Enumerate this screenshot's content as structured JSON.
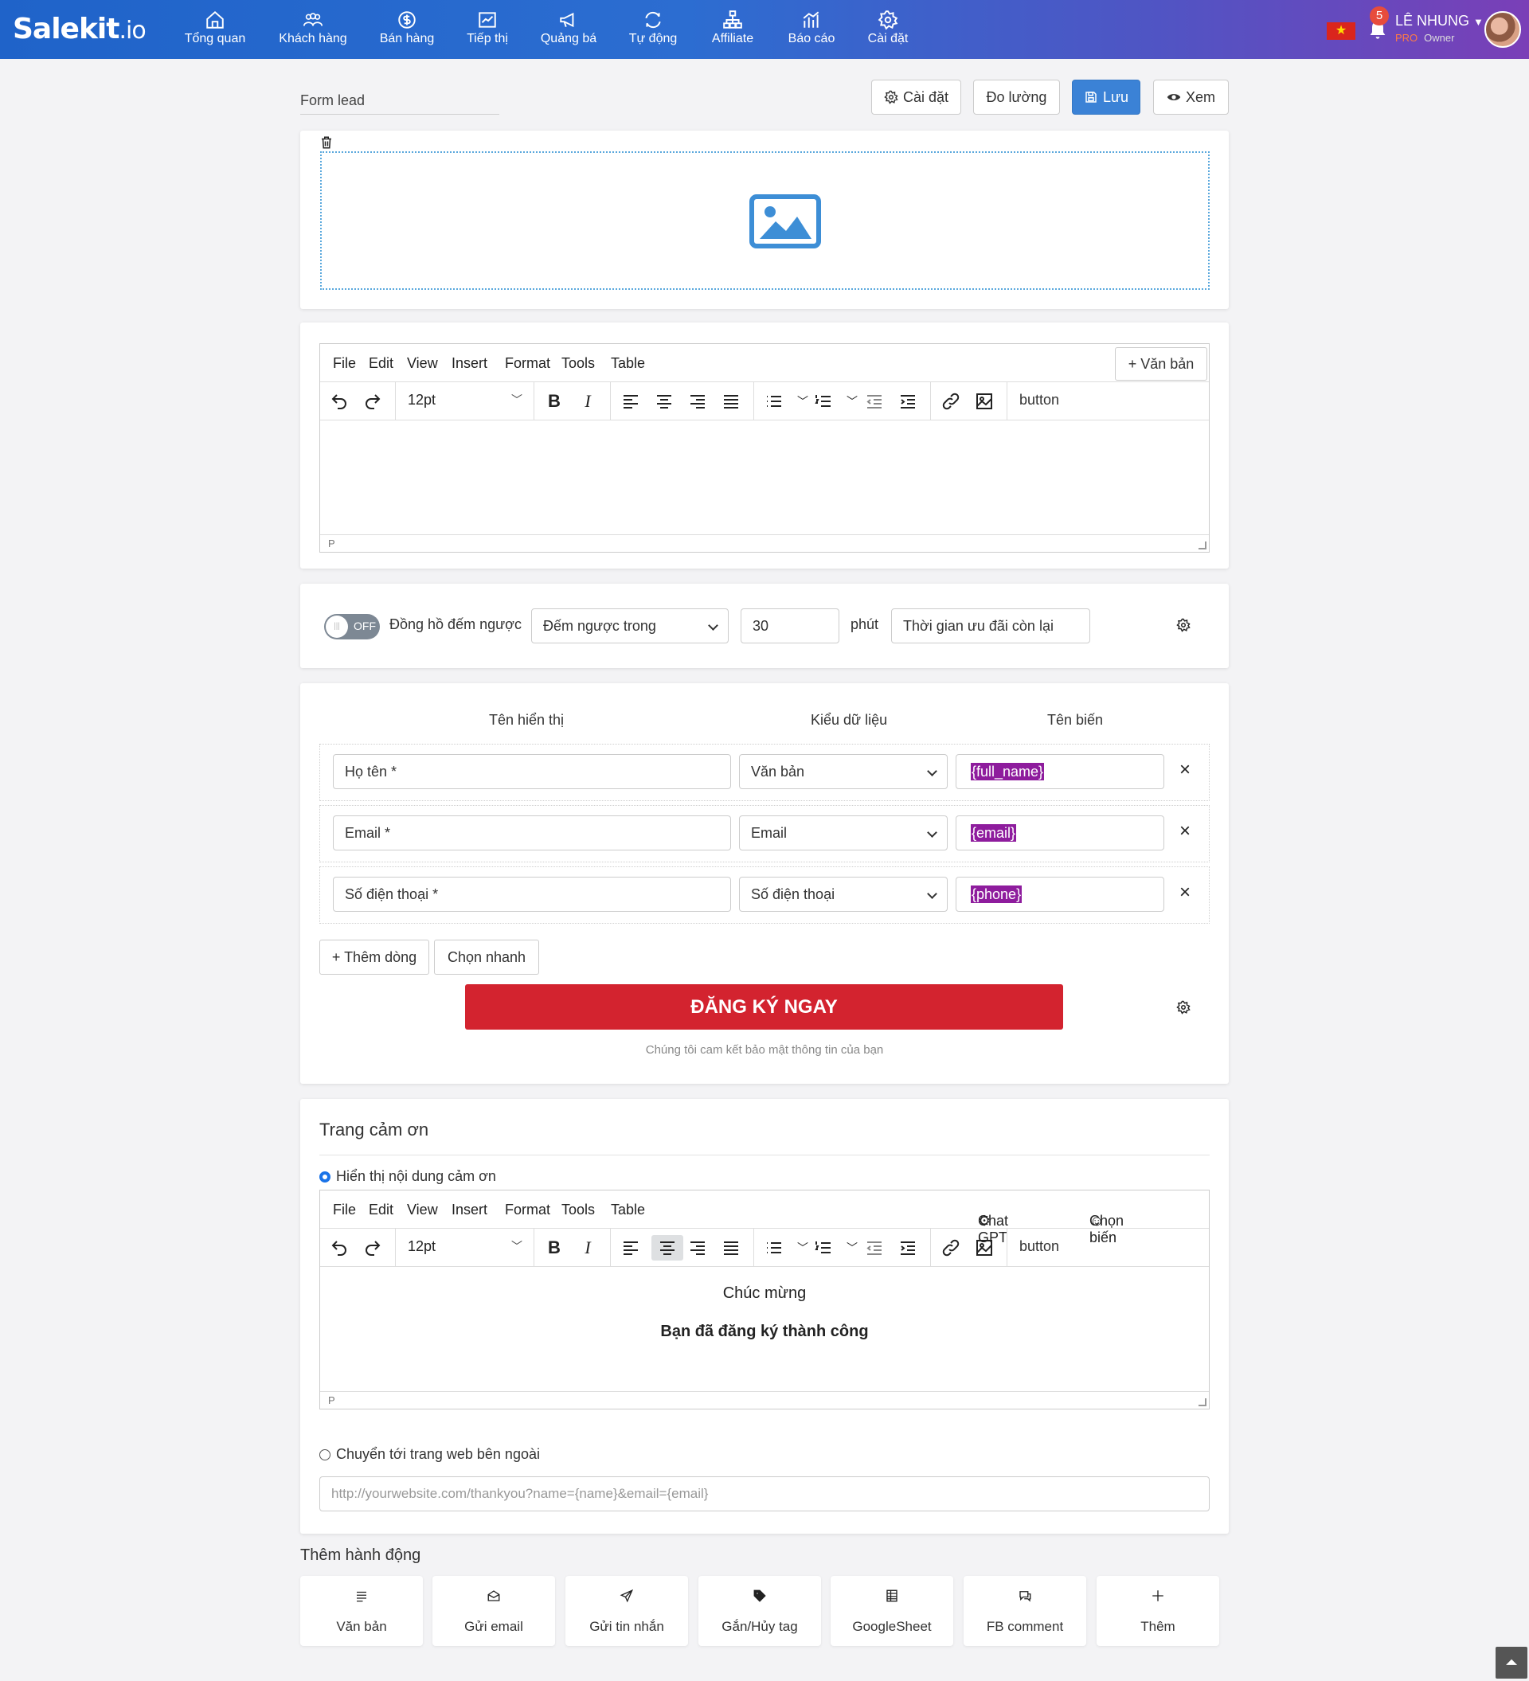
{
  "brand": {
    "name": "Salekit",
    "suffix": ".io"
  },
  "nav": [
    {
      "label": "Tổng quan",
      "icon": "home-icon"
    },
    {
      "label": "Khách hàng",
      "icon": "users-icon"
    },
    {
      "label": "Bán hàng",
      "icon": "dollar-icon"
    },
    {
      "label": "Tiếp thị",
      "icon": "trend-icon"
    },
    {
      "label": "Quảng bá",
      "icon": "megaphone-icon"
    },
    {
      "label": "Tự động",
      "icon": "sync-icon"
    },
    {
      "label": "Affiliate",
      "icon": "sitemap-icon"
    },
    {
      "label": "Báo cáo",
      "icon": "chart-icon"
    },
    {
      "label": "Cài đặt",
      "icon": "gear-icon"
    }
  ],
  "user": {
    "notifications": "5",
    "name": "LÊ NHUNG",
    "plan": "PRO",
    "role": "Owner",
    "flag": "★"
  },
  "toolbar": {
    "form_name": "Form lead",
    "settings": "Cài đặt",
    "measure": "Đo lường",
    "save": "Lưu",
    "view": "Xem"
  },
  "editor_menu": [
    "File",
    "Edit",
    "View",
    "Insert",
    "Format",
    "Tools",
    "Table"
  ],
  "editor": {
    "font_size": "12pt",
    "button_word": "button",
    "status": "P",
    "add_text": "+ Văn bản"
  },
  "countdown": {
    "toggle": "OFF",
    "label": "Đồng hồ đếm ngược",
    "mode": "Đếm ngược trong",
    "minutes": "30",
    "unit": "phút",
    "text": "Thời gian ưu đãi còn lại"
  },
  "fields": {
    "headers": {
      "display": "Tên hiển thị",
      "type": "Kiểu dữ liệu",
      "var": "Tên biến"
    },
    "rows": [
      {
        "display": "Họ tên *",
        "type": "Văn bản",
        "var": "{full_name}"
      },
      {
        "display": "Email *",
        "type": "Email",
        "var": "{email}"
      },
      {
        "display": "Số điện thoại *",
        "type": "Số điện thoại",
        "var": "{phone}"
      }
    ],
    "add_row": "+ Thêm dòng",
    "quick": "Chọn nhanh",
    "cta": "ĐĂNG KÝ NGAY",
    "privacy": "Chúng tôi cam kết bảo mật thông tin của bạn"
  },
  "thanks": {
    "title": "Trang cảm ơn",
    "opt_show": "Hiển thị nội dung cảm ơn",
    "chatgpt": "Chat GPT",
    "pick_var": "Chọn biến",
    "line1": "Chúc mừng",
    "line2": "Bạn đã đăng ký thành công",
    "opt_redirect": "Chuyển tới trang web bên ngoài",
    "url_placeholder": "http://yourwebsite.com/thankyou?name={name}&email={email}"
  },
  "actions": {
    "title": "Thêm hành động",
    "items": [
      {
        "label": "Văn bản",
        "icon": "text-icon"
      },
      {
        "label": "Gửi email",
        "icon": "envelope-icon"
      },
      {
        "label": "Gửi tin nhắn",
        "icon": "send-icon"
      },
      {
        "label": "Gắn/Hủy tag",
        "icon": "tag-icon"
      },
      {
        "label": "GoogleSheet",
        "icon": "sheet-icon"
      },
      {
        "label": "FB comment",
        "icon": "comment-icon"
      },
      {
        "label": "Thêm",
        "icon": "plus-icon"
      }
    ]
  }
}
